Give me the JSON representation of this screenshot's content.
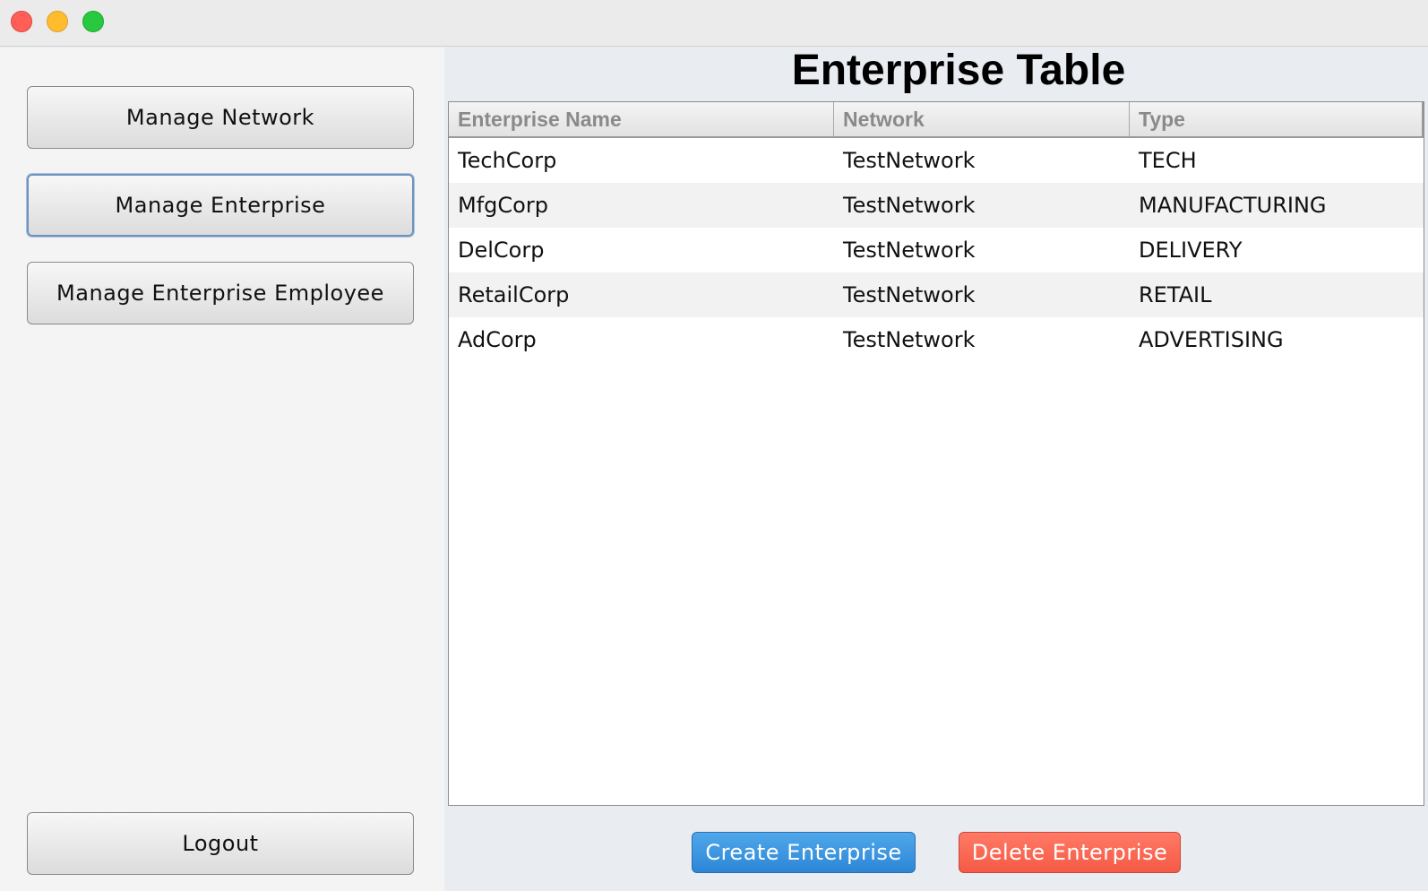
{
  "window": {
    "controls": [
      "close",
      "minimize",
      "maximize"
    ]
  },
  "sidebar": {
    "buttons": [
      {
        "label": "Manage Network"
      },
      {
        "label": "Manage Enterprise"
      },
      {
        "label": "Manage Enterprise Employee"
      }
    ],
    "logout_label": "Logout"
  },
  "main": {
    "title": "Enterprise Table",
    "table": {
      "columns": [
        "Enterprise Name",
        "Network",
        "Type"
      ],
      "rows": [
        [
          "TechCorp",
          "TestNetwork",
          "TECH"
        ],
        [
          "MfgCorp",
          "TestNetwork",
          "MANUFACTURING"
        ],
        [
          "DelCorp",
          "TestNetwork",
          "DELIVERY"
        ],
        [
          "RetailCorp",
          "TestNetwork",
          "RETAIL"
        ],
        [
          "AdCorp",
          "TestNetwork",
          "ADVERTISING"
        ]
      ]
    },
    "create_label": "Create Enterprise",
    "delete_label": "Delete Enterprise"
  },
  "colors": {
    "create_button": "#3896e0",
    "delete_button": "#f96653",
    "focus_ring": "#6f93bf"
  }
}
